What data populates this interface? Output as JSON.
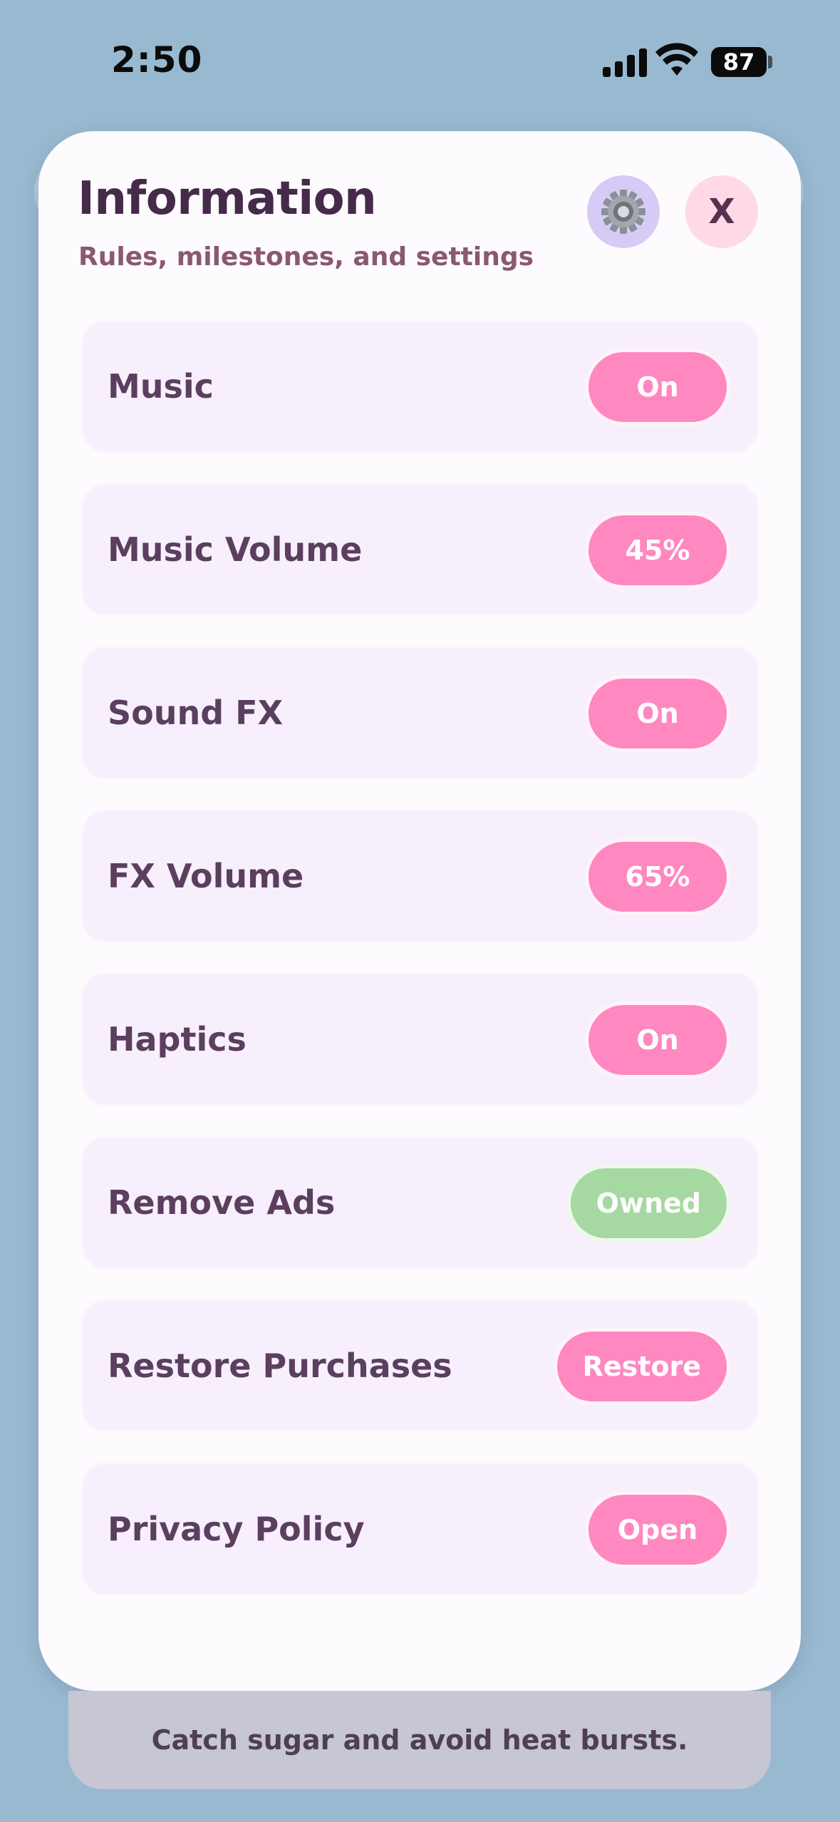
{
  "status_bar": {
    "time": "2:50",
    "battery": "87"
  },
  "modal": {
    "title": "Information",
    "subtitle": "Rules, milestones, and settings",
    "close_label": "X"
  },
  "settings": [
    {
      "label": "Music",
      "value": "On"
    },
    {
      "label": "Music Volume",
      "value": "45%"
    },
    {
      "label": "Sound FX",
      "value": "On"
    },
    {
      "label": "FX Volume",
      "value": "65%"
    },
    {
      "label": "Haptics",
      "value": "On"
    },
    {
      "label": "Remove Ads",
      "value": "Owned"
    },
    {
      "label": "Restore Purchases",
      "value": "Restore"
    },
    {
      "label": "Privacy Policy",
      "value": "Open"
    }
  ],
  "toast": {
    "text": "Catch sugar and avoid heat bursts."
  },
  "colors": {
    "background": "#98b9d0",
    "accent_pink": "#ff88c1",
    "owned_green": "#a6d8a1",
    "title": "#452a4a"
  }
}
